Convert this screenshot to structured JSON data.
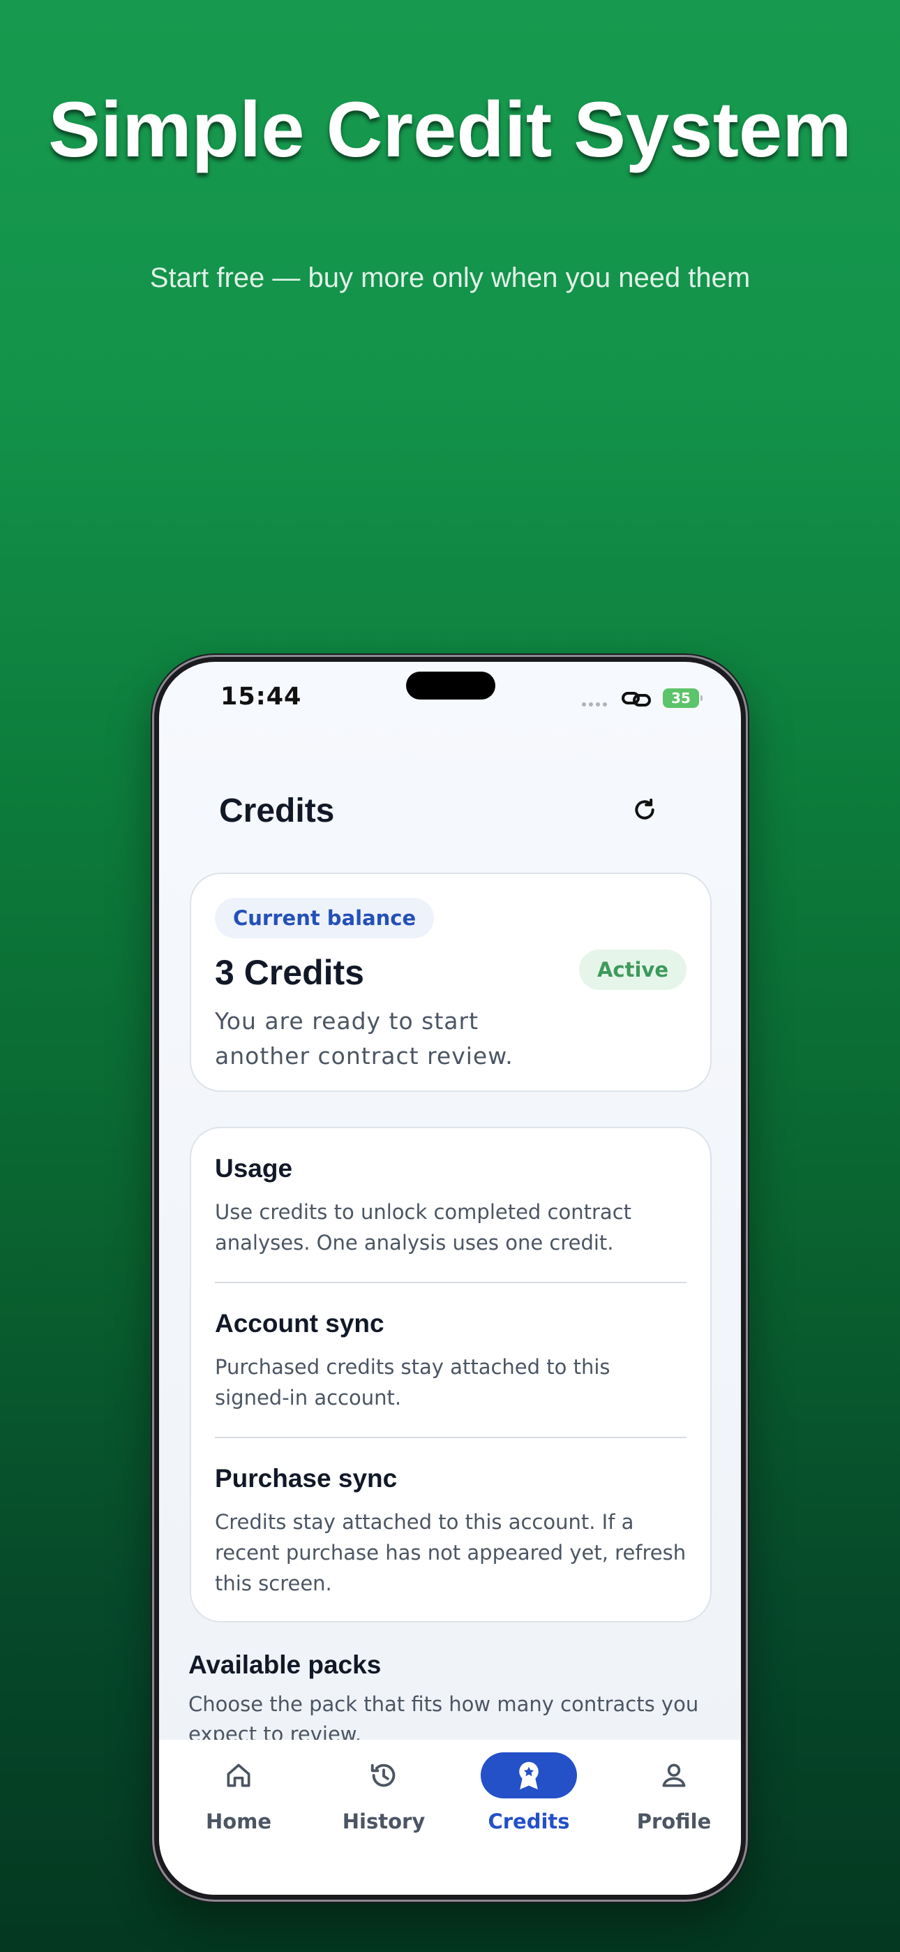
{
  "hero": {
    "title": "Simple Credit System",
    "subtitle": "Start free — buy more only when you need them"
  },
  "status_bar": {
    "time": "15:44",
    "battery": "35"
  },
  "header": {
    "title": "Credits",
    "refresh_icon": "refresh-icon"
  },
  "balance_card": {
    "label": "Current balance",
    "value": "3 Credits",
    "status": "Active",
    "description": "You are ready to start another contract review."
  },
  "info_card": {
    "sections": [
      {
        "heading": "Usage",
        "body": "Use credits to unlock completed contract analyses. One analysis uses one credit."
      },
      {
        "heading": "Account sync",
        "body": "Purchased credits stay attached to this signed-in account."
      },
      {
        "heading": "Purchase sync",
        "body": "Credits stay attached to this account. If a recent purchase has not appeared yet, refresh this screen."
      }
    ]
  },
  "packs": {
    "title": "Available packs",
    "description": "Choose the pack that fits how many contracts you expect to review."
  },
  "tabbar": {
    "items": [
      {
        "label": "Home",
        "icon": "home-icon"
      },
      {
        "label": "History",
        "icon": "history-icon"
      },
      {
        "label": "Credits",
        "icon": "award-icon",
        "active": true
      },
      {
        "label": "Profile",
        "icon": "profile-icon"
      }
    ]
  },
  "colors": {
    "accent": "#2450c8",
    "success": "#3d9a5b",
    "background_top": "#179a4f",
    "background_bottom": "#043820"
  }
}
